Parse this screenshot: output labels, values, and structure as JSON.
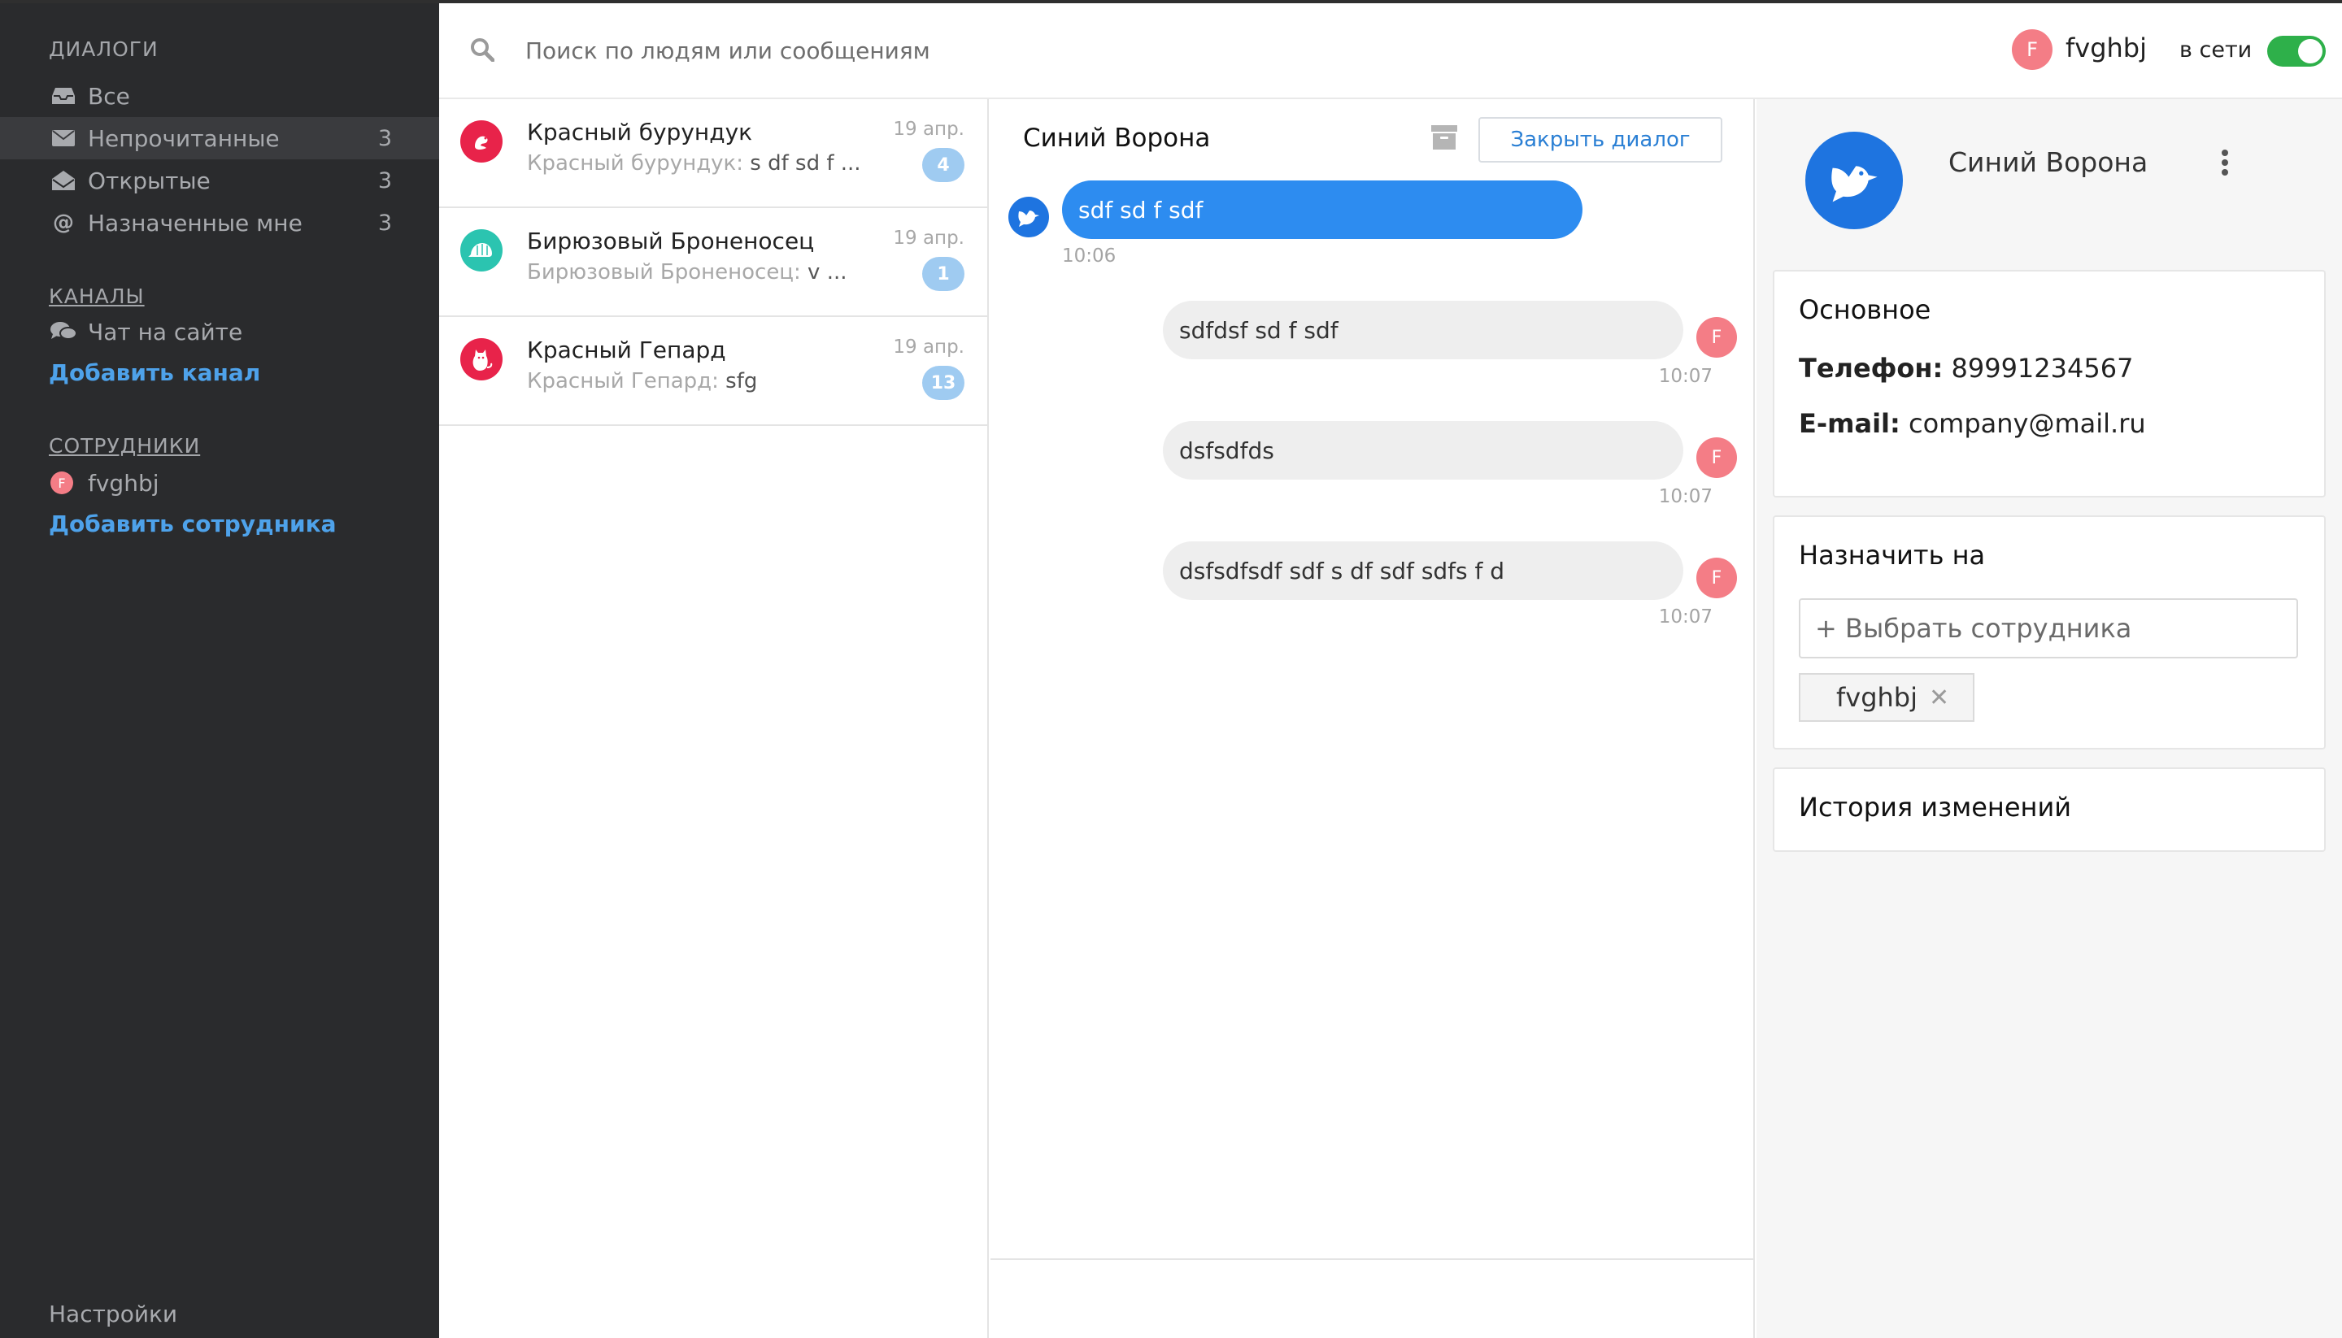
{
  "sidebar": {
    "dialogs_title": "ДИАЛОГИ",
    "items": [
      {
        "label": "Все",
        "count": ""
      },
      {
        "label": "Непрочитанные",
        "count": "3"
      },
      {
        "label": "Открытые",
        "count": "3"
      },
      {
        "label": "Назначенные мне",
        "count": "3"
      }
    ],
    "channels_title": "КАНАЛЫ",
    "channels": [
      {
        "label": "Чат на сайте"
      }
    ],
    "add_channel": "Добавить канал",
    "employees_title": "СОТРУДНИКИ",
    "employees": [
      {
        "initial": "F",
        "name": "fvghbj"
      }
    ],
    "add_employee": "Добавить сотрудника",
    "settings": "Настройки"
  },
  "topbar": {
    "search_placeholder": "Поиск по людям или сообщениям",
    "user_initial": "F",
    "user_name": "fvghbj",
    "status_label": "в сети",
    "online": true
  },
  "conversations": [
    {
      "name": "Красный бурундук",
      "preview_prefix": "Красный бурундук:",
      "preview_text": " s df sd f ...",
      "date": "19 апр.",
      "unread": "4",
      "avatar_color": "#e8234a"
    },
    {
      "name": "Бирюзовый Броненосец",
      "preview_prefix": "Бирюзовый Броненосец:",
      "preview_text": " v ...",
      "date": "19 апр.",
      "unread": "1",
      "avatar_color": "#2bc4b0"
    },
    {
      "name": "Красный Гепард",
      "preview_prefix": "Красный Гепард:",
      "preview_text": " sfg",
      "date": "19 апр.",
      "unread": "13",
      "avatar_color": "#e8234a"
    }
  ],
  "chat": {
    "title": "Синий Ворона",
    "close_button": "Закрыть диалог",
    "messages": [
      {
        "direction": "in",
        "text": "sdf sd f sdf",
        "time": "10:06"
      },
      {
        "direction": "out",
        "text": "sdfdsf sd f sdf",
        "time": "10:07",
        "initial": "F"
      },
      {
        "direction": "out",
        "text": "dsfsdfds",
        "time": "10:07",
        "initial": "F"
      },
      {
        "direction": "out",
        "text": "dsfsdfsdf sdf s df sdf sdfs f d",
        "time": "10:07",
        "initial": "F"
      }
    ]
  },
  "contact": {
    "name": "Синий Ворона",
    "main_title": "Основное",
    "phone_label": "Телефон:",
    "phone": "89991234567",
    "email_label": "E-mail:",
    "email": "company@mail.ru",
    "assign_title": "Назначить на",
    "assign_placeholder": "+ Выбрать сотрудника",
    "assigned_tag": "fvghbj",
    "history_title": "История изменений"
  },
  "colors": {
    "sidebar_bg": "#2a2b2d",
    "accent_blue": "#2d8cf0",
    "link_blue": "#4ea2ea",
    "online_green": "#2eb04a",
    "badge_blue": "#9fcbf1",
    "avatar_pink": "#f47d86"
  }
}
